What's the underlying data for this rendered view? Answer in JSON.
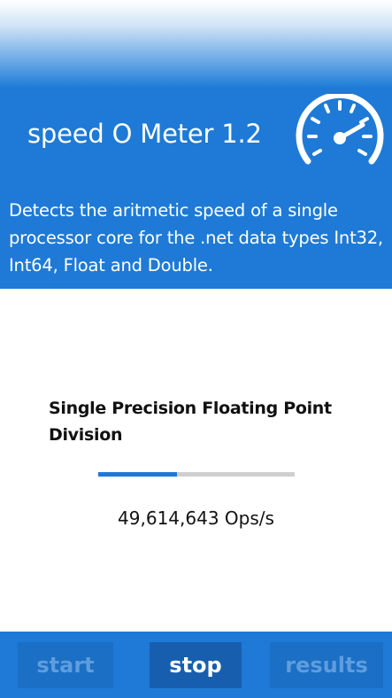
{
  "header": {
    "title": "speed O Meter 1.2",
    "icon": "speedometer-icon",
    "description": "Detects the aritmetic speed of a single processor core for the .net data types Int32, Int64, Float and Double."
  },
  "test": {
    "name": "Single Precision Floating Point Division",
    "progress_percent": 40,
    "result": "49,614,643 Ops/s"
  },
  "buttons": {
    "start": "start",
    "stop": "stop",
    "results": "results"
  },
  "colors": {
    "accent": "#1e7ad6",
    "button_bg": "#1b6fc4",
    "button_active_bg": "#175fae",
    "button_disabled_text": "#5f9ddd",
    "progress_track": "#cfcfcf"
  }
}
